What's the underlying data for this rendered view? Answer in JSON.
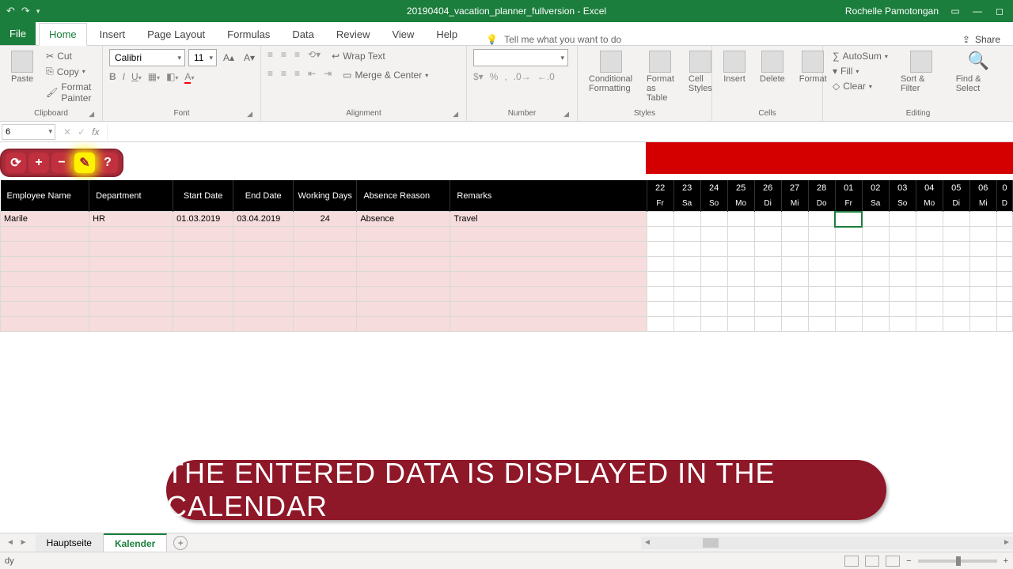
{
  "titlebar": {
    "filename": "20190404_vacation_planner_fullversion - Excel",
    "user": "Rochelle Pamotongan"
  },
  "ribbon": {
    "tabs": [
      "File",
      "Home",
      "Insert",
      "Page Layout",
      "Formulas",
      "Data",
      "Review",
      "View",
      "Help"
    ],
    "active_index": 1,
    "tell_me": "Tell me what you want to do",
    "share": "Share",
    "font": {
      "name": "Calibri",
      "size": "11"
    },
    "clipboard": {
      "cut": "Cut",
      "copy": "Copy",
      "paste": "Paste",
      "fmtpainter": "Format Painter",
      "label": "Clipboard"
    },
    "fontgroup": {
      "label": "Font"
    },
    "alignment": {
      "wrap": "Wrap Text",
      "merge": "Merge & Center",
      "label": "Alignment"
    },
    "number": {
      "label": "Number"
    },
    "styles": {
      "cond": "Conditional Formatting",
      "fat": "Format as Table",
      "cell": "Cell Styles",
      "label": "Styles"
    },
    "cells": {
      "insert": "Insert",
      "delete": "Delete",
      "format": "Format",
      "label": "Cells"
    },
    "editing": {
      "autosum": "AutoSum",
      "fill": "Fill",
      "clear": "Clear",
      "sort": "Sort & Filter",
      "find": "Find & Select",
      "label": "Editing"
    }
  },
  "formula": {
    "name_box": "6",
    "fx": "fx"
  },
  "custom_toolbar": {
    "b1": "⟳",
    "b2": "+",
    "b3": "−",
    "b4": "✎",
    "b5": "?"
  },
  "headers": [
    "Employee Name",
    "Department",
    "Start Date",
    "End Date",
    "Working Days",
    "Absence Reason",
    "Remarks"
  ],
  "row": {
    "name": "Marile",
    "dept": "HR",
    "start": "01.03.2019",
    "end": "03.04.2019",
    "days": "24",
    "reason": "Absence",
    "remarks": "Travel"
  },
  "cal_days": [
    "22",
    "23",
    "24",
    "25",
    "26",
    "27",
    "28",
    "01",
    "02",
    "03",
    "04",
    "05",
    "06",
    "0"
  ],
  "cal_dow": [
    "Fr",
    "Sa",
    "So",
    "Mo",
    "Di",
    "Mi",
    "Do",
    "Fr",
    "Sa",
    "So",
    "Mo",
    "Di",
    "Mi",
    "D"
  ],
  "weekend_idx": [
    1,
    2,
    8,
    9
  ],
  "absence_idx": [
    7,
    8,
    9,
    10,
    11,
    12,
    13
  ],
  "sheet_tabs": {
    "t1": "Hauptseite",
    "t2": "Kalender"
  },
  "status": {
    "left": "dy"
  },
  "banner": "THE ENTERED DATA IS DISPLAYED IN THE CALENDAR"
}
